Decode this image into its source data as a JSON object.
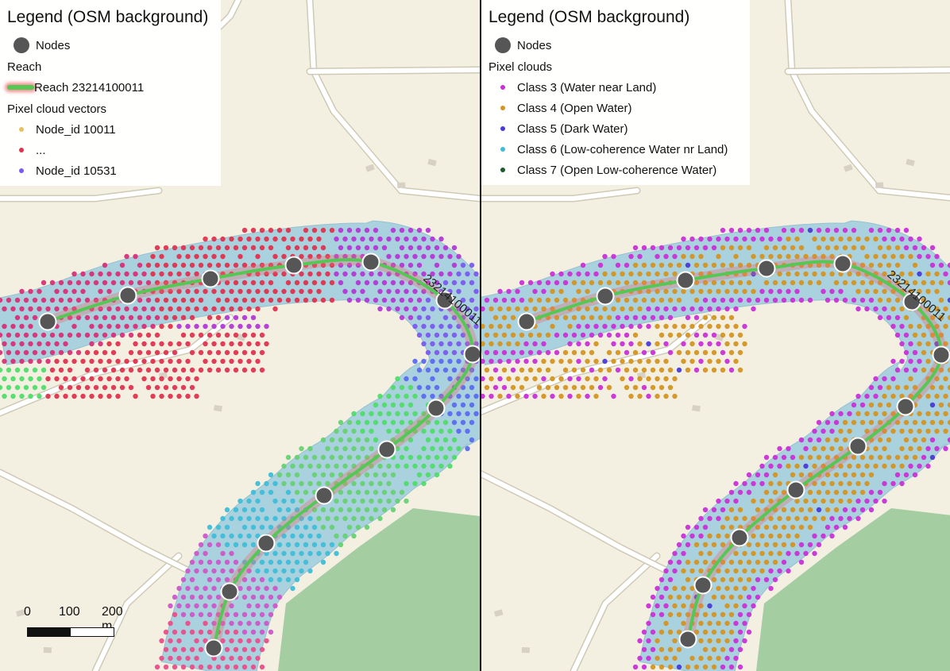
{
  "left_panel": {
    "legend": {
      "title": "Legend (OSM background)",
      "nodes_label": "Nodes",
      "reach_section": "Reach",
      "reach_label": "Reach 23214100011",
      "vectors_section": "Pixel cloud vectors",
      "items": [
        {
          "label": "Node_id 10011",
          "color": "#e6c15c"
        },
        {
          "label": "...",
          "color": "#e0324e"
        },
        {
          "label": "Node_id 10531",
          "color": "#7a5af0"
        }
      ]
    },
    "reach_map_label": "23214100011",
    "scale": {
      "labels": [
        "0",
        "100",
        "200 m"
      ]
    }
  },
  "right_panel": {
    "legend": {
      "title": "Legend (OSM background)",
      "nodes_label": "Nodes",
      "clouds_section": "Pixel clouds",
      "classes": [
        {
          "label": "Class 3 (Water near Land)",
          "color": "#c930d6"
        },
        {
          "label": "Class 4 (Open Water)",
          "color": "#d49421"
        },
        {
          "label": "Class 5 (Dark Water)",
          "color": "#4a3bd6"
        },
        {
          "label": "Class 6 (Low-coherence Water nr Land)",
          "color": "#3fbdd8"
        },
        {
          "label": "Class 7 (Open Low-coherence Water)",
          "color": "#1d5a2a"
        }
      ]
    },
    "reach_map_label": "23214100011"
  },
  "colors": {
    "land": "#f3f0e1",
    "river": "#a9d1de",
    "forest": "#9bc99a",
    "reach_line": "#55c755",
    "node": "#565656",
    "road": "#ffffff"
  },
  "icons": [
    "node-circle-icon",
    "reach-line-icon",
    "pixel-dot-icon"
  ]
}
